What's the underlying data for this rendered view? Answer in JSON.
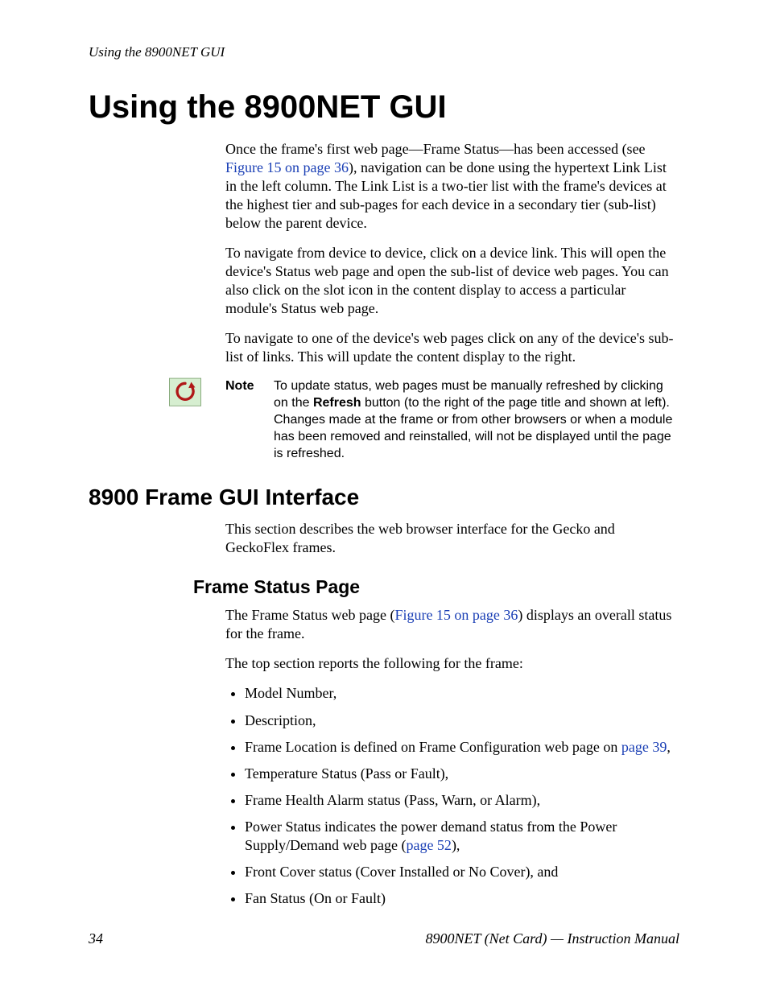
{
  "runningHead": "Using the 8900NET GUI",
  "title": "Using the 8900NET GUI",
  "intro": {
    "p1a": "Once the frame's first web page—Frame Status—has been accessed (see ",
    "p1link": "Figure 15 on page 36",
    "p1b": "), navigation can be done using the hypertext Link List in the left column. The Link List is a two-tier list with the frame's devices at the highest tier and sub-pages for each device in a secondary tier (sub-list) below the parent device.",
    "p2": "To navigate from device to device, click on a device link. This will open the device's Status web page and open the sub-list of device web pages. You can also click on the slot icon in the content display to access a particular module's Status web page.",
    "p3": "To navigate to one of the device's web pages click on any of the device's sub-list of links. This will update the content display to the right."
  },
  "note": {
    "label": "Note",
    "t1": "To update status, web pages must be manually refreshed by clicking on the ",
    "bold": "Refresh",
    "t2": " button (to the right of the page title and shown at left). Changes made at the frame or from other browsers or when a module has been removed and reinstalled, will not be displayed until the page is refreshed."
  },
  "section2": {
    "heading": "8900 Frame GUI Interface",
    "p1": "This section describes the web browser interface for the Gecko and GeckoFlex frames."
  },
  "section3": {
    "heading": "Frame Status Page",
    "p1a": "The Frame Status web page (",
    "p1link": "Figure 15 on page 36",
    "p1b": ") displays an overall status for the frame.",
    "p2": "The top section reports the following for the frame:",
    "bullets": {
      "b0": "Model Number,",
      "b1": "Description,",
      "b2a": "Frame Location is defined on Frame Configuration web page on ",
      "b2link": "page 39",
      "b2b": ",",
      "b3": "Temperature Status (Pass or Fault),",
      "b4": "Frame Health Alarm status (Pass, Warn, or Alarm),",
      "b5a": "Power Status indicates the power demand status from the Power Supply/Demand web page (",
      "b5link": "page 52",
      "b5b": "),",
      "b6": "Front Cover status (Cover Installed or No Cover), and",
      "b7": "Fan Status (On or Fault)"
    }
  },
  "footer": {
    "pageNumber": "34",
    "docTitle": "8900NET (Net Card) — Instruction Manual"
  }
}
